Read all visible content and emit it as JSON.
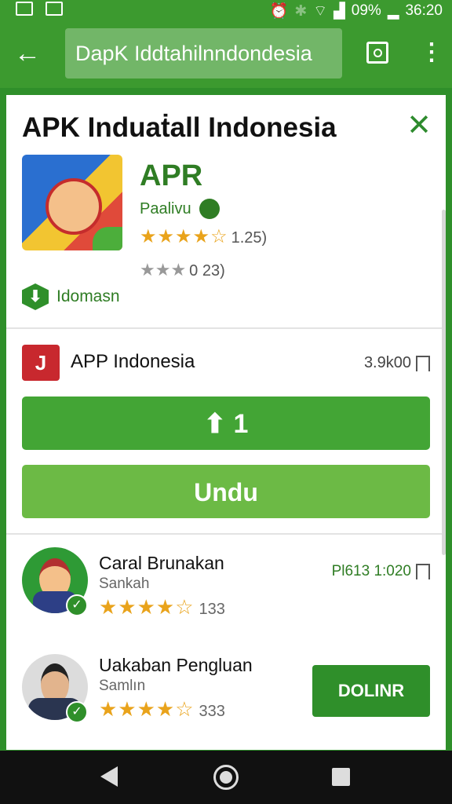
{
  "status_bar": {
    "battery": "09%",
    "time": "36:20"
  },
  "app_bar": {
    "search_value": "DapK Iddtahilnndondesia"
  },
  "dialog": {
    "title": "APK Induaṫall Indonesia",
    "app": {
      "name": "APR",
      "developer": "Paalivu",
      "rating_stars": "★★★★☆",
      "rating_count": "1.25)",
      "secondary_stars": "★★★",
      "secondary_count": "0 23)",
      "badge_label": "Idomasn"
    },
    "publisher": {
      "name": "APP Indonesia",
      "size": "3.9k00"
    },
    "buttons": {
      "update_label": "1",
      "download_label": "Undu"
    },
    "related": [
      {
        "name": "Caral Brunakan",
        "subtitle": "Sankah",
        "stars": "★★★★☆",
        "count": "133",
        "price": "Pl613 1:020"
      },
      {
        "name": "Uakaban Pengluan",
        "subtitle": "Samlın",
        "stars": "★★★★☆",
        "count": "333",
        "action_label": "DOLINR"
      }
    ]
  },
  "colors": {
    "primary": "#3c9a2f",
    "button": "#43a535",
    "download": "#6cba45",
    "star": "#e9a31b"
  }
}
